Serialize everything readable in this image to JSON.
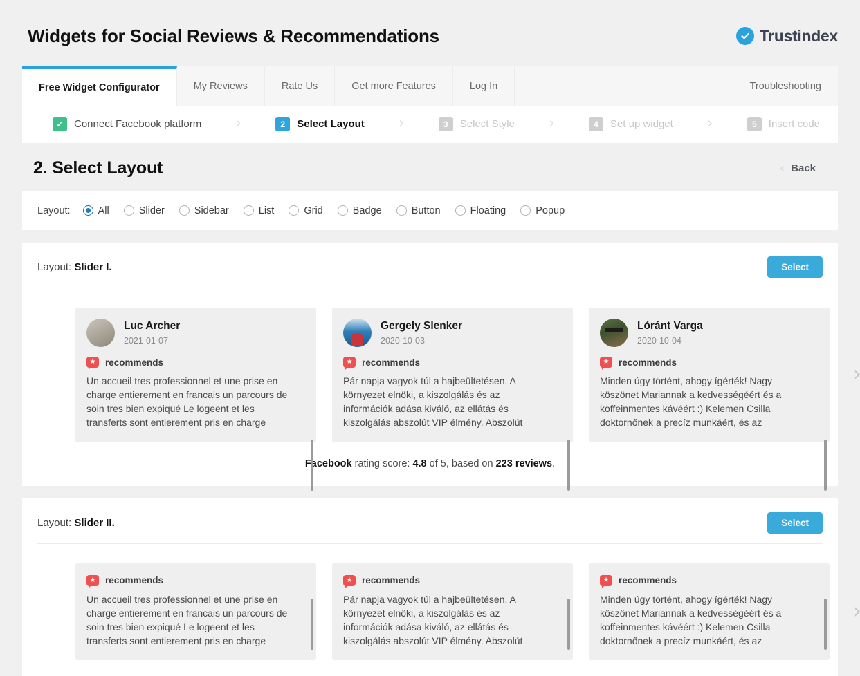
{
  "header": {
    "title": "Widgets for Social Reviews & Recommendations",
    "brand_name": "Trustindex",
    "brand_icon": "check-circle-icon",
    "brand_color": "#2aa3dd"
  },
  "tabs": [
    {
      "label": "Free Widget Configurator",
      "active": true
    },
    {
      "label": "My Reviews",
      "active": false
    },
    {
      "label": "Rate Us",
      "active": false
    },
    {
      "label": "Get more Features",
      "active": false
    },
    {
      "label": "Log In",
      "active": false
    }
  ],
  "tab_right": {
    "label": "Troubleshooting"
  },
  "steps": [
    {
      "num": "✓",
      "label": "Connect Facebook platform",
      "state": "done"
    },
    {
      "num": "2",
      "label": "Select Layout",
      "state": "current"
    },
    {
      "num": "3",
      "label": "Select Style",
      "state": "todo"
    },
    {
      "num": "4",
      "label": "Set up widget",
      "state": "todo"
    },
    {
      "num": "5",
      "label": "Insert code",
      "state": "todo"
    }
  ],
  "section": {
    "title": "2. Select Layout",
    "back_label": "Back"
  },
  "filter": {
    "label": "Layout:",
    "options": [
      {
        "label": "All",
        "checked": true
      },
      {
        "label": "Slider",
        "checked": false
      },
      {
        "label": "Sidebar",
        "checked": false
      },
      {
        "label": "List",
        "checked": false
      },
      {
        "label": "Grid",
        "checked": false
      },
      {
        "label": "Badge",
        "checked": false
      },
      {
        "label": "Button",
        "checked": false
      },
      {
        "label": "Floating",
        "checked": false
      },
      {
        "label": "Popup",
        "checked": false
      }
    ]
  },
  "layouts": [
    {
      "prefix": "Layout:",
      "name": "Slider I.",
      "select_label": "Select",
      "show_author": true,
      "reviews": [
        {
          "author": "Luc Archer",
          "date": "2021-01-07",
          "recommends": "recommends",
          "text": "Un accueil tres professionnel et une prise en charge entierement en francais un parcours de soin tres bien expiqué Le logeent et les transferts sont entierement pris en charge"
        },
        {
          "author": "Gergely Slenker",
          "date": "2020-10-03",
          "recommends": "recommends",
          "text": "Pár napja vagyok túl a hajbeültetésen. A környezet elnöki, a kiszolgálás és az információk adása kiváló, az ellátás és kiszolgálás abszolút VIP élmény. Abszolút"
        },
        {
          "author": "Lóránt Varga",
          "date": "2020-10-04",
          "recommends": "recommends",
          "text": "Minden úgy történt, ahogy ígérték! Nagy köszönet Mariannak a kedvességéért és a koffeinmentes kávéért :) Kelemen Csilla doktornőnek a precíz munkáért, és az"
        }
      ],
      "rating": {
        "platform": "Facebook",
        "mid_1": " rating score: ",
        "score": "4.8",
        "mid_2": " of 5, based on ",
        "reviews_count": "223 reviews",
        "suffix": "."
      }
    },
    {
      "prefix": "Layout:",
      "name": "Slider II.",
      "select_label": "Select",
      "show_author": false,
      "reviews": [
        {
          "author": "",
          "date": "",
          "recommends": "recommends",
          "text": "Un accueil tres professionnel et une prise en charge entierement en francais un parcours de soin tres bien expiqué Le logeent et les transferts sont entierement pris en charge"
        },
        {
          "author": "",
          "date": "",
          "recommends": "recommends",
          "text": "Pár napja vagyok túl a hajbeültetésen. A környezet elnöki, a kiszolgálás és az információk adása kiváló, az ellátás és kiszolgálás abszolút VIP élmény. Abszolút"
        },
        {
          "author": "",
          "date": "",
          "recommends": "recommends",
          "text": "Minden úgy történt, ahogy ígérték! Nagy köszönet Mariannak a kedvességéért és a koffeinmentes kávéért :) Kelemen Csilla doktornőnek a precíz munkáért, és az"
        }
      ]
    }
  ],
  "icons": {
    "next_arrow": "›",
    "step_sep": "›",
    "back_chevron": "‹",
    "star": "★"
  }
}
